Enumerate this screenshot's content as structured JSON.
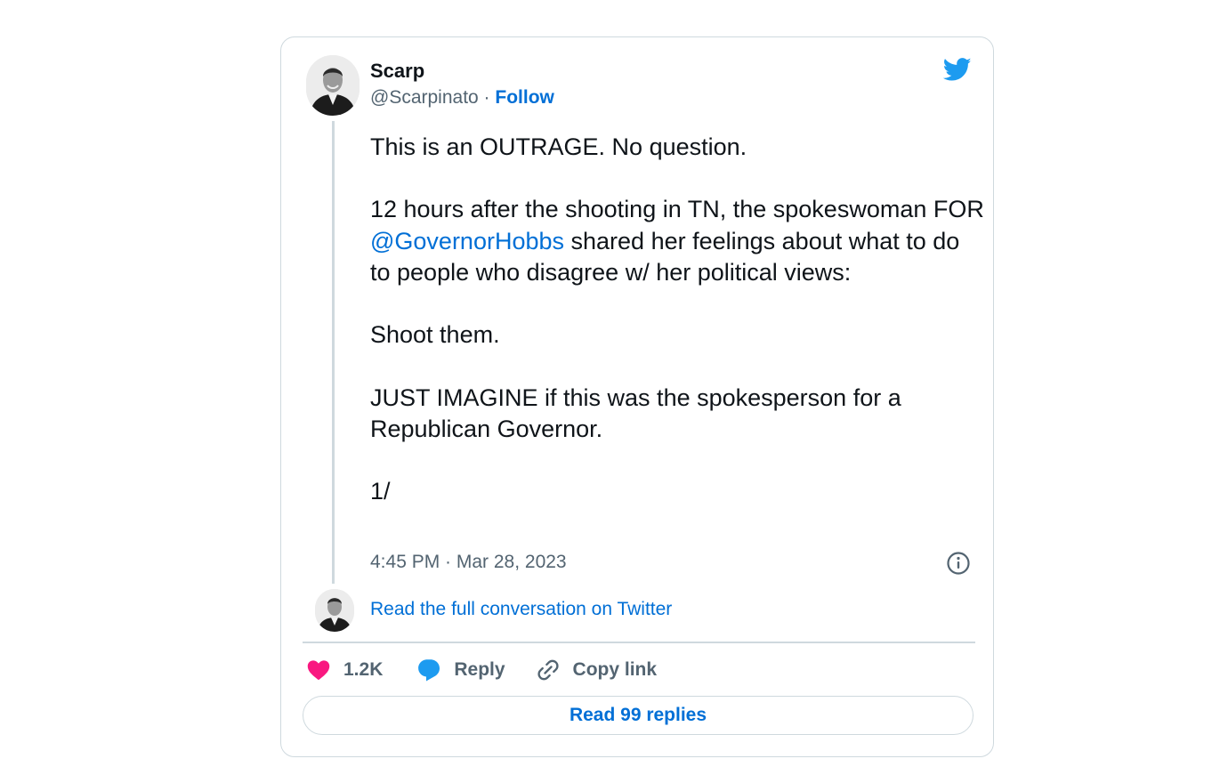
{
  "author": {
    "name": "Scarp",
    "handle": "@Scarpinato",
    "separator": " · ",
    "follow_label": "Follow"
  },
  "tweet": {
    "line1": "This is an OUTRAGE. No question.",
    "para2_before": "12 hours after the shooting in TN, the spokeswoman FOR ",
    "mention": "@GovernorHobbs",
    "para2_after": " shared her feelings about what to do to people who disagree w/ her political views:",
    "line3": "Shoot them.",
    "line4": "JUST IMAGINE if this was the spokesperson for a Republican Governor.",
    "line5": "1/"
  },
  "timestamp": "4:45 PM · Mar 28, 2023",
  "read_conversation_label": "Read the full conversation on Twitter",
  "actions": {
    "like_count": "1.2K",
    "reply_label": "Reply",
    "copy_link_label": "Copy link"
  },
  "read_replies_label": "Read 99 replies",
  "colors": {
    "link": "#006fd6",
    "like": "#f91880",
    "reply_icon": "#1d9bf0",
    "twitter_bird": "#1d9bf0",
    "muted": "#536471",
    "border": "#cfd9de"
  },
  "icons": [
    "twitter-bird-icon",
    "info-icon",
    "heart-icon",
    "reply-bubble-icon",
    "link-icon"
  ]
}
